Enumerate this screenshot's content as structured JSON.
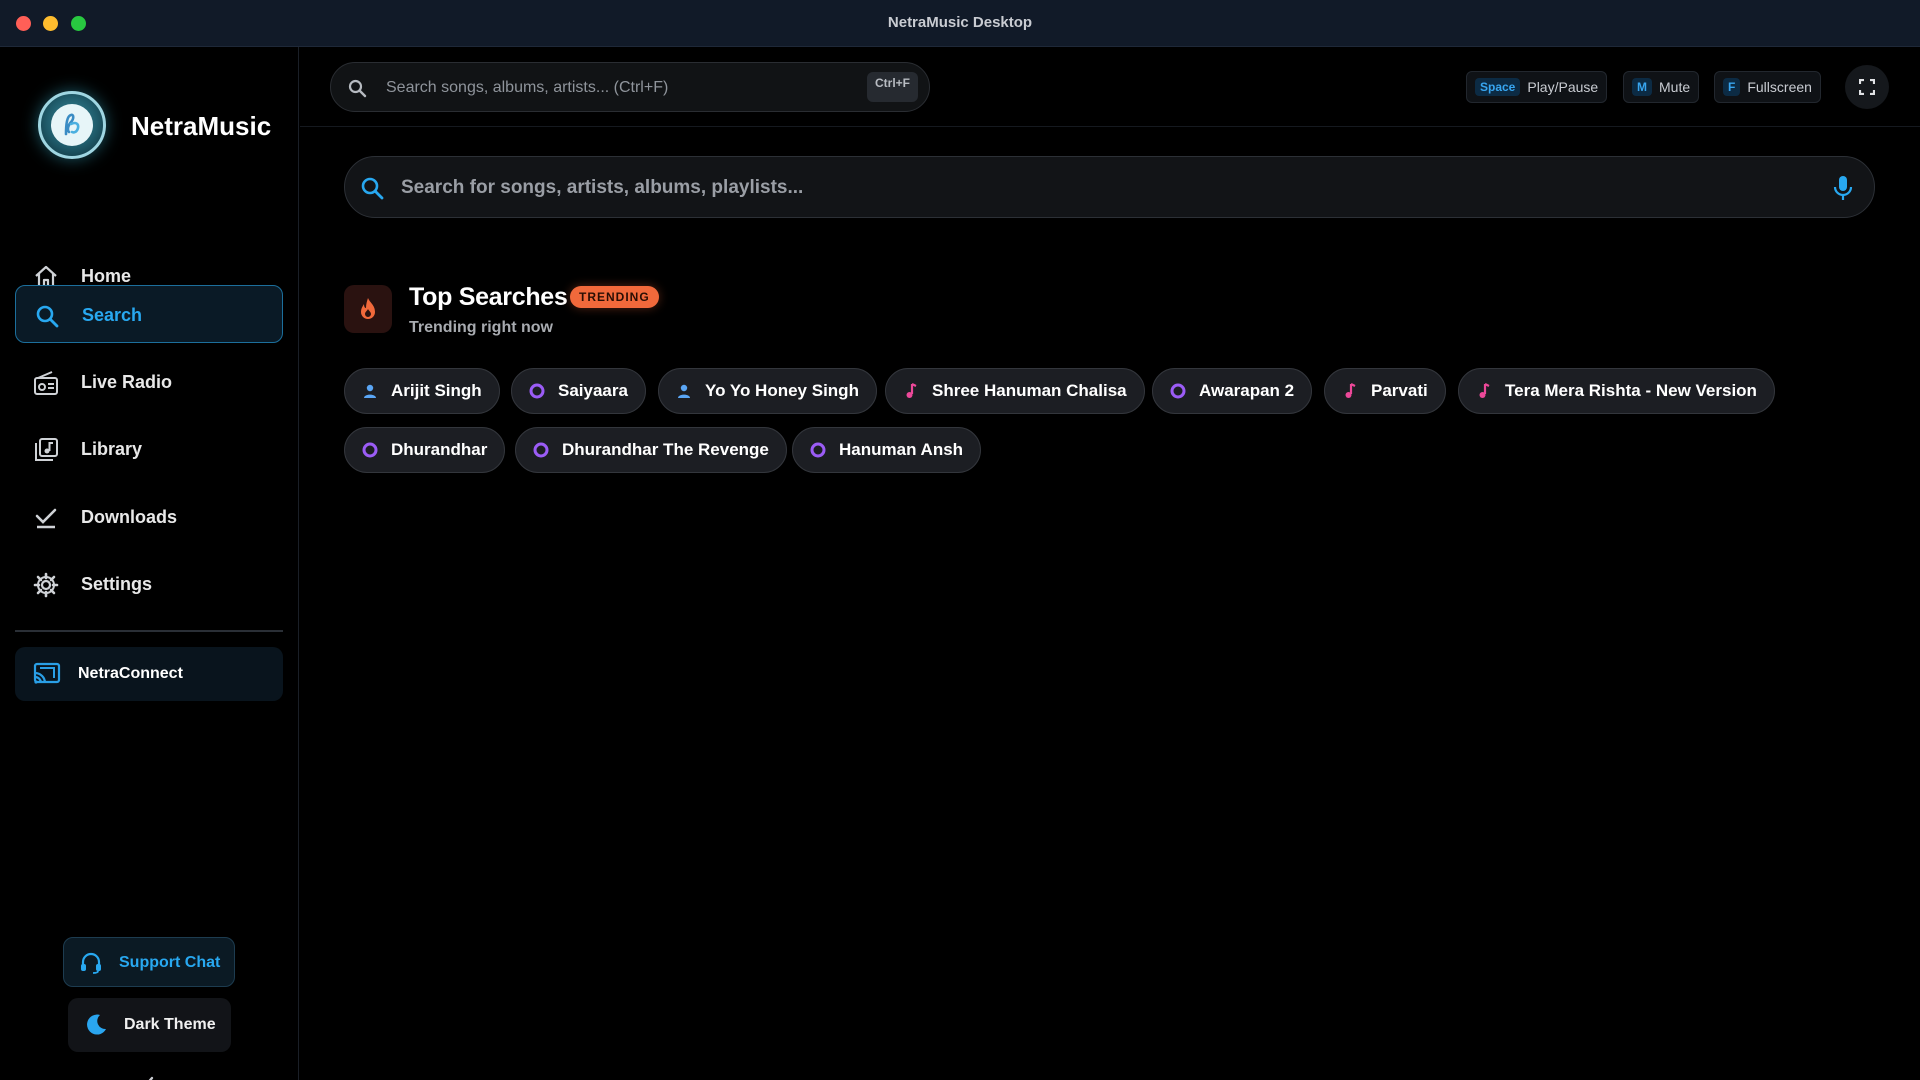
{
  "window": {
    "title": "NetraMusic Desktop"
  },
  "sidebar": {
    "brand": "NetraMusic",
    "items": [
      {
        "label": "Home",
        "icon": "home-icon"
      },
      {
        "label": "Search",
        "icon": "search-icon",
        "active": true
      },
      {
        "label": "Live Radio",
        "icon": "radio-icon"
      },
      {
        "label": "Library",
        "icon": "library-icon"
      },
      {
        "label": "Downloads",
        "icon": "download-check-icon"
      },
      {
        "label": "Settings",
        "icon": "gear-icon"
      }
    ],
    "connect_label": "NetraConnect",
    "support_label": "Support Chat",
    "theme_label": "Dark Theme"
  },
  "toolbar": {
    "search_placeholder": "Search songs, albums, artists... (Ctrl+F)",
    "search_shortcut": "Ctrl+F",
    "hints": [
      {
        "key": "Space",
        "label": "Play/Pause"
      },
      {
        "key": "M",
        "label": "Mute"
      },
      {
        "key": "F",
        "label": "Fullscreen"
      }
    ]
  },
  "main": {
    "search_placeholder": "Search for songs, artists, albums, playlists...",
    "section_title": "Top Searches",
    "badge": "TRENDING",
    "subtitle": "Trending right now",
    "chips": [
      {
        "label": "Arijit Singh",
        "type": "artist"
      },
      {
        "label": "Saiyaara",
        "type": "album"
      },
      {
        "label": "Yo Yo Honey Singh",
        "type": "artist"
      },
      {
        "label": "Shree Hanuman Chalisa",
        "type": "song"
      },
      {
        "label": "Awarapan 2",
        "type": "album"
      },
      {
        "label": "Parvati",
        "type": "song"
      },
      {
        "label": "Tera Mera Rishta - New Version",
        "type": "song"
      },
      {
        "label": "Dhurandhar",
        "type": "album"
      },
      {
        "label": "Dhurandhar The Revenge",
        "type": "album"
      },
      {
        "label": "Hanuman Ansh",
        "type": "album"
      }
    ]
  },
  "colors": {
    "accent": "#28a8f0",
    "trending": "#f1693b",
    "artist_icon": "#5aa6f5",
    "album_icon": "#9b5cf6",
    "song_icon": "#ec4899"
  }
}
